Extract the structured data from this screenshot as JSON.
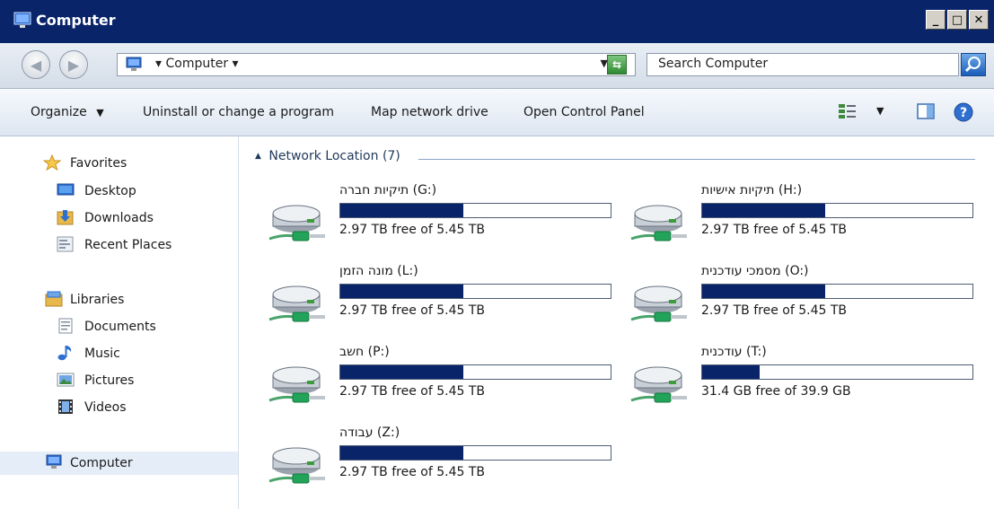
{
  "window": {
    "title": "Computer"
  },
  "address": {
    "crumb": "Computer",
    "crumb_arrow": "▾",
    "dropdown_arrow": "▼",
    "search_placeholder": "Search Computer"
  },
  "toolbar": {
    "organize_label": "Organize",
    "organize_arrow": "▼",
    "uninstall_label": "Uninstall or change a program",
    "map_drive_label": "Map network drive",
    "control_panel_label": "Open Control Panel",
    "view_arrow": "▼"
  },
  "sidebar": {
    "favorites": {
      "label": "Favorites",
      "icon": "star-icon"
    },
    "favorites_items": [
      {
        "label": "Desktop",
        "icon": "desktop-icon"
      },
      {
        "label": "Downloads",
        "icon": "downloads-icon"
      },
      {
        "label": "Recent Places",
        "icon": "recent-places-icon"
      }
    ],
    "libraries": {
      "label": "Libraries",
      "icon": "libraries-icon"
    },
    "library_items": [
      {
        "label": "Documents",
        "icon": "document-icon"
      },
      {
        "label": "Music",
        "icon": "music-icon"
      },
      {
        "label": "Pictures",
        "icon": "pictures-icon"
      },
      {
        "label": "Videos",
        "icon": "video-icon"
      }
    ],
    "computer": {
      "label": "Computer",
      "icon": "computer-icon"
    }
  },
  "content": {
    "group_arrow": "▲",
    "group_label": "Network Location (7)",
    "drives": [
      {
        "name": "תיקיות חברה (G:)",
        "free": "2.97 TB free of 5.45 TB",
        "used_fraction": 0.455
      },
      {
        "name": "תיקיות אישיות (H:)",
        "free": "2.97 TB free of 5.45 TB",
        "used_fraction": 0.455
      },
      {
        "name": "מונה הזמן (L:)",
        "free": "2.97 TB free of 5.45 TB",
        "used_fraction": 0.455
      },
      {
        "name": "מסמכי עודכנית (O:)",
        "free": "2.97 TB free of 5.45 TB",
        "used_fraction": 0.455
      },
      {
        "name": "חשב (P:)",
        "free": "2.97 TB free of 5.45 TB",
        "used_fraction": 0.455
      },
      {
        "name": "עודכנית (T:)",
        "free": "31.4 GB free of 39.9 GB",
        "used_fraction": 0.213
      },
      {
        "name": "עבודה (Z:)",
        "free": "2.97 TB free of 5.45 TB",
        "used_fraction": 0.455
      }
    ]
  },
  "colors": {
    "titlebar": "#0a246a",
    "usage_fill": "#0a246a"
  }
}
